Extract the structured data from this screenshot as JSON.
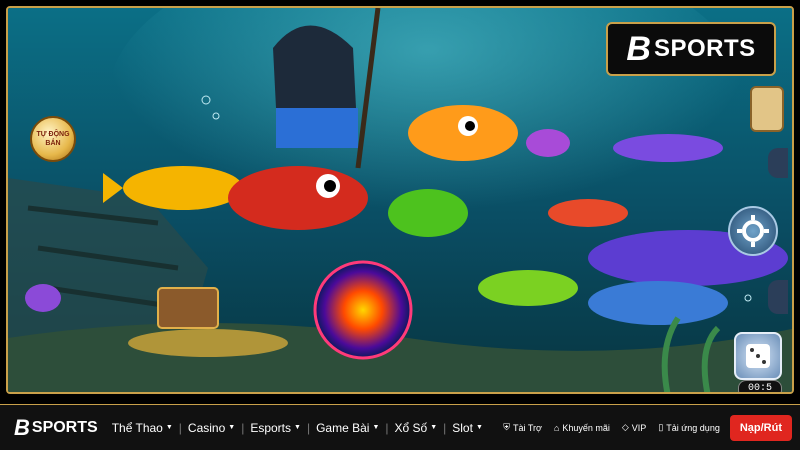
{
  "brand": {
    "mark": "B",
    "text": "SPORTS"
  },
  "game": {
    "auto_fire_line1": "TỰ ĐỘNG",
    "auto_fire_line2": "BẮN",
    "timer": "00:5",
    "icons": [
      "gear-icon",
      "dice-icon",
      "map-icon",
      "help-icon",
      "exit-icon"
    ]
  },
  "nav": {
    "logo_mark": "B",
    "logo_text": "SPORTS",
    "menu": [
      {
        "label": "Thể Thao"
      },
      {
        "label": "Casino"
      },
      {
        "label": "Esports"
      },
      {
        "label": "Game Bài"
      },
      {
        "label": "Xổ Số"
      },
      {
        "label": "Slot"
      }
    ],
    "links": [
      {
        "label": "Tài Trợ",
        "icon": "shield-icon"
      },
      {
        "label": "Khuyến mãi",
        "icon": "tag-icon"
      },
      {
        "label": "VIP",
        "icon": "diamond-icon"
      },
      {
        "label": "Tải ứng dụng",
        "icon": "phone-icon"
      }
    ],
    "cta": "Nạp/Rút"
  },
  "colors": {
    "accent": "#c9a04a",
    "cta": "#e0261f",
    "ocean": "#0b4e6b"
  }
}
